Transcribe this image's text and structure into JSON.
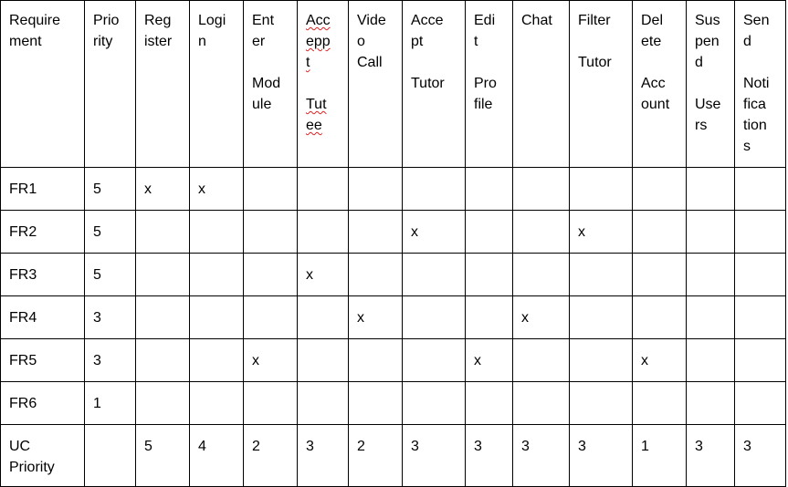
{
  "table": {
    "headers": [
      "Require\nment",
      "Prio\nrity",
      "Reg\nister",
      "Logi\nn",
      "Ent\ner\n\nMod\nule",
      "Acc\nepp\nt\n\nTut\nee",
      "Vide\no\nCall",
      "Acce\npt\n\nTutor",
      "Edi\nt\n\nPro\nfile",
      "Chat",
      "Filter\n\nTutor",
      "Del\nete\n\nAcc\nount",
      "Sus\npen\nd\n\nUse\nrs",
      "Sen\nd\n\nNoti\nfica\ntion\ns"
    ],
    "rows": [
      [
        "FR1",
        "5",
        "x",
        "x",
        "",
        "",
        "",
        "",
        "",
        "",
        "",
        "",
        "",
        ""
      ],
      [
        "FR2",
        "5",
        "",
        "",
        "",
        "",
        "",
        "x",
        "",
        "",
        "x",
        "",
        "",
        ""
      ],
      [
        "FR3",
        "5",
        "",
        "",
        "",
        "x",
        "",
        "",
        "",
        "",
        "",
        "",
        "",
        ""
      ],
      [
        "FR4",
        "3",
        "",
        "",
        "",
        "",
        "x",
        "",
        "",
        "x",
        "",
        "",
        "",
        ""
      ],
      [
        "FR5",
        "3",
        "",
        "",
        "x",
        "",
        "",
        "",
        "x",
        "",
        "",
        "x",
        "",
        ""
      ],
      [
        "FR6",
        "1",
        "",
        "",
        "",
        "",
        "",
        "",
        "",
        "",
        "",
        "",
        "",
        ""
      ]
    ],
    "footer": [
      "UC\nPriority",
      "",
      "5",
      "4",
      "2",
      "3",
      "2",
      "3",
      "3",
      "3",
      "3",
      "1",
      "3",
      "3"
    ]
  }
}
